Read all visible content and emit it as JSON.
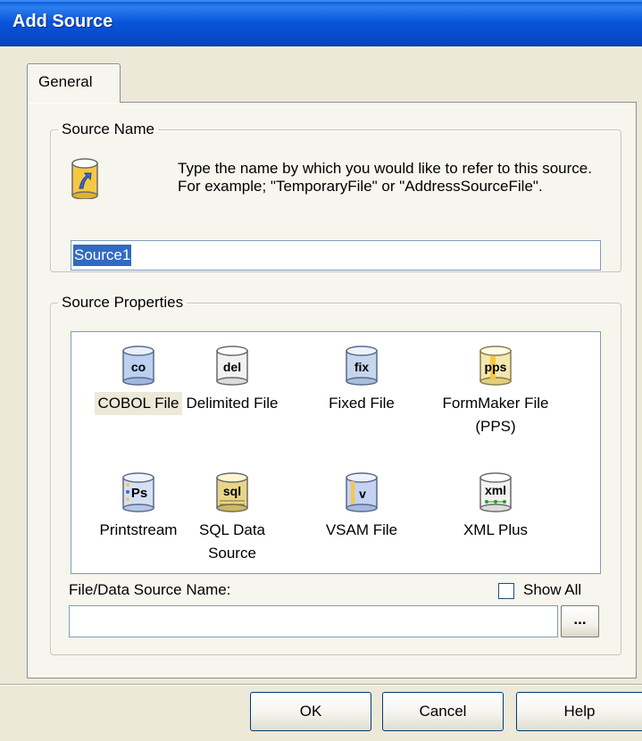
{
  "window": {
    "title": "Add Source"
  },
  "tabs": [
    {
      "label": "General"
    }
  ],
  "source_name": {
    "legend": "Source Name",
    "description": "Type the name by which you would like to refer to this source.  For example; \"TemporaryFile\" or \"AddressSourceFile\".",
    "input_value": "Source1"
  },
  "source_properties": {
    "legend": "Source Properties",
    "items": [
      {
        "label": "COBOL File",
        "icon": "cobol-file-icon",
        "selected": true
      },
      {
        "label": "Delimited File",
        "icon": "delimited-file-icon"
      },
      {
        "label": "Fixed File",
        "icon": "fixed-file-icon"
      },
      {
        "label": "FormMaker File (PPS)",
        "icon": "formmaker-file-icon"
      },
      {
        "label": "Printstream",
        "icon": "printstream-icon"
      },
      {
        "label": "SQL Data Source",
        "icon": "sql-data-source-icon"
      },
      {
        "label": "VSAM File",
        "icon": "vsam-file-icon"
      },
      {
        "label": "XML Plus",
        "icon": "xml-plus-icon"
      }
    ],
    "file_label": "File/Data Source Name:",
    "file_value": "",
    "show_all_label": "Show All",
    "show_all_checked": false,
    "browse_label": "..."
  },
  "buttons": {
    "ok": "OK",
    "cancel": "Cancel",
    "help": "Help"
  }
}
